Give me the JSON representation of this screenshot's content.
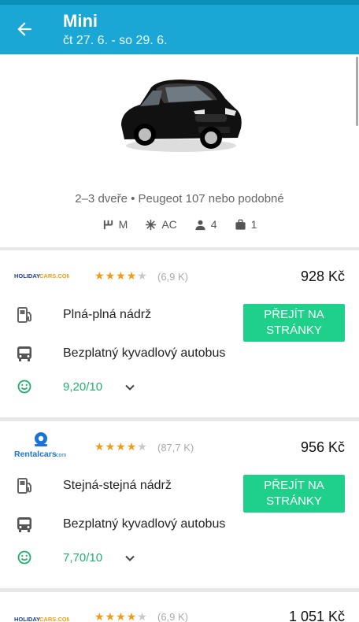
{
  "appbar": {
    "title": "Mini",
    "subtitle": "čt 27. 6. - so 29. 6."
  },
  "car": {
    "description": "2–3 dveře • Peugeot 107 nebo podobné",
    "specs": {
      "transmission": "M",
      "ac": "AC",
      "seats": "4",
      "bags": "1"
    }
  },
  "offers": [
    {
      "provider_logo": "HOLIDAYCARS.COM",
      "rating_stars": 4,
      "reviews": "(6,9 K)",
      "price": "928 Kč",
      "fuel_policy": "Plná-plná nádrž",
      "shuttle": "Bezplatný kyvadlový autobus",
      "score": "9,20/10",
      "button": "PŘEJÍT NA STRÁNKY"
    },
    {
      "provider_logo": "Rentalcars.com",
      "rating_stars": 4,
      "reviews": "(87,7 K)",
      "price": "956 Kč",
      "fuel_policy": "Stejná-stejná nádrž",
      "shuttle": "Bezplatný kyvadlový autobus",
      "score": "7,70/10",
      "button": "PŘEJÍT NA STRÁNKY"
    },
    {
      "provider_logo": "HOLIDAYCARS.COM",
      "rating_stars": 4,
      "reviews": "(6,9 K)",
      "price": "1 051 Kč"
    }
  ],
  "colors": {
    "appbar": "#1aa7d6",
    "button": "#1ed08a",
    "score": "#1bb36b",
    "star": "#f39c12"
  }
}
